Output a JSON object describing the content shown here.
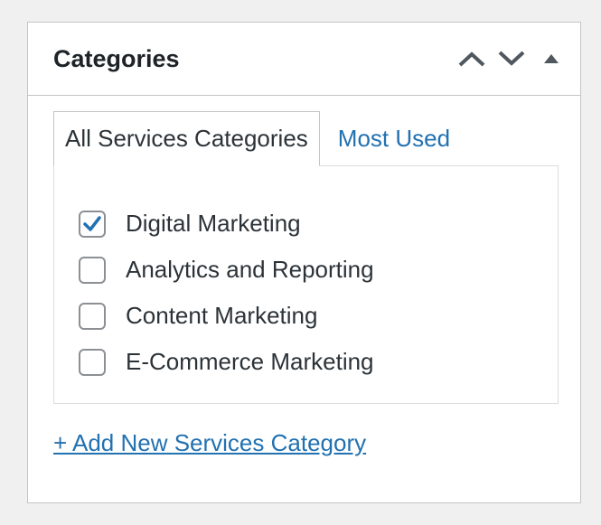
{
  "metabox": {
    "title": "Categories",
    "controls": [
      {
        "name": "move-up",
        "icon": "chevron-up-icon"
      },
      {
        "name": "move-down",
        "icon": "chevron-down-icon"
      },
      {
        "name": "toggle-panel",
        "icon": "triangle-up-icon"
      }
    ]
  },
  "tabs": [
    {
      "label": "All Services Categories",
      "active": true
    },
    {
      "label": "Most Used",
      "active": false
    }
  ],
  "categories": [
    {
      "label": "Digital Marketing",
      "checked": true
    },
    {
      "label": "Analytics and Reporting",
      "checked": false
    },
    {
      "label": "Content Marketing",
      "checked": false
    },
    {
      "label": "E-Commerce Marketing",
      "checked": false
    }
  ],
  "add_link": "+ Add New Services Category",
  "colors": {
    "link": "#2271b1",
    "check": "#2271b1",
    "border": "#c3c4c7",
    "text": "#2c3338",
    "background": "#f0f0f1"
  }
}
